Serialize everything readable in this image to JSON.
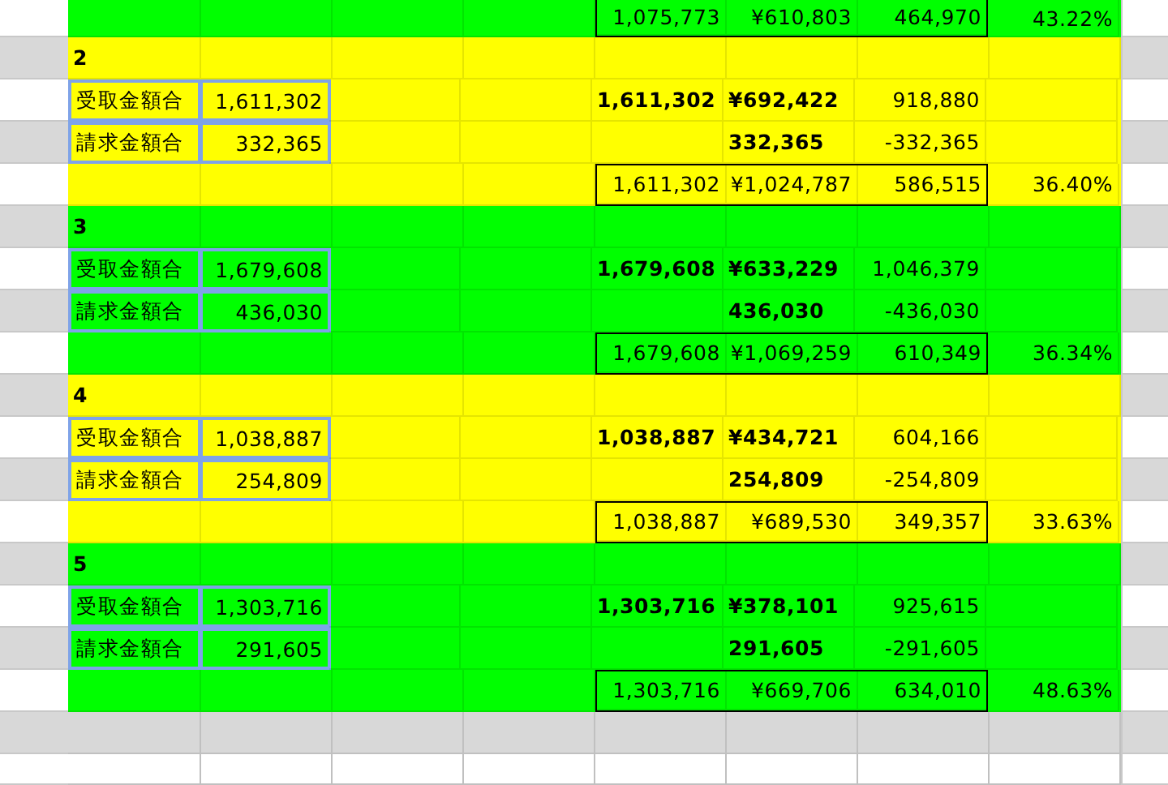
{
  "blocks": [
    {
      "color": "#00ff00",
      "rows": [
        {
          "kind": "total",
          "column_5": "1,075,773",
          "column_6": "¥610,803",
          "column_7": "464,970",
          "column_8": "43.22%"
        }
      ]
    },
    {
      "color": "#ffff00",
      "rows": [
        {
          "kind": "title",
          "title": "2"
        },
        {
          "kind": "item",
          "label": "受取金額合",
          "value": "1,611,302",
          "column_5": "1,611,302",
          "column_6": "¥692,422",
          "column_7": "918,880"
        },
        {
          "kind": "item",
          "label": "請求金額合",
          "value": "332,365",
          "column_6": "332,365",
          "column_7": "-332,365"
        },
        {
          "kind": "total",
          "column_5": "1,611,302",
          "column_6": "¥1,024,787",
          "column_7": "586,515",
          "column_8": "36.40%"
        }
      ]
    },
    {
      "color": "#00ff00",
      "rows": [
        {
          "kind": "title",
          "title": "3"
        },
        {
          "kind": "item",
          "label": "受取金額合",
          "value": "1,679,608",
          "column_5": "1,679,608",
          "column_6": "¥633,229",
          "column_7": "1,046,379"
        },
        {
          "kind": "item",
          "label": "請求金額合",
          "value": "436,030",
          "column_6": "436,030",
          "column_7": "-436,030"
        },
        {
          "kind": "total",
          "column_5": "1,679,608",
          "column_6": "¥1,069,259",
          "column_7": "610,349",
          "column_8": "36.34%"
        }
      ]
    },
    {
      "color": "#ffff00",
      "rows": [
        {
          "kind": "title",
          "title": "4"
        },
        {
          "kind": "item",
          "label": "受取金額合",
          "value": "1,038,887",
          "column_5": "1,038,887",
          "column_6": "¥434,721",
          "column_7": "604,166"
        },
        {
          "kind": "item",
          "label": "請求金額合",
          "value": "254,809",
          "column_6": "254,809",
          "column_7": "-254,809"
        },
        {
          "kind": "total",
          "column_5": "1,038,887",
          "column_6": "¥689,530",
          "column_7": "349,357",
          "column_8": "33.63%"
        }
      ]
    },
    {
      "color": "#00ff00",
      "rows": [
        {
          "kind": "title",
          "title": "5"
        },
        {
          "kind": "item",
          "label": "受取金額合",
          "value": "1,303,716",
          "column_5": "1,303,716",
          "column_6": "¥378,101",
          "column_7": "925,615"
        },
        {
          "kind": "item",
          "label": "請求金額合",
          "value": "291,605",
          "column_6": "291,605",
          "column_7": "-291,605"
        },
        {
          "kind": "total",
          "column_5": "1,303,716",
          "column_6": "¥669,706",
          "column_7": "634,010",
          "column_8": "48.63%"
        }
      ]
    }
  ]
}
